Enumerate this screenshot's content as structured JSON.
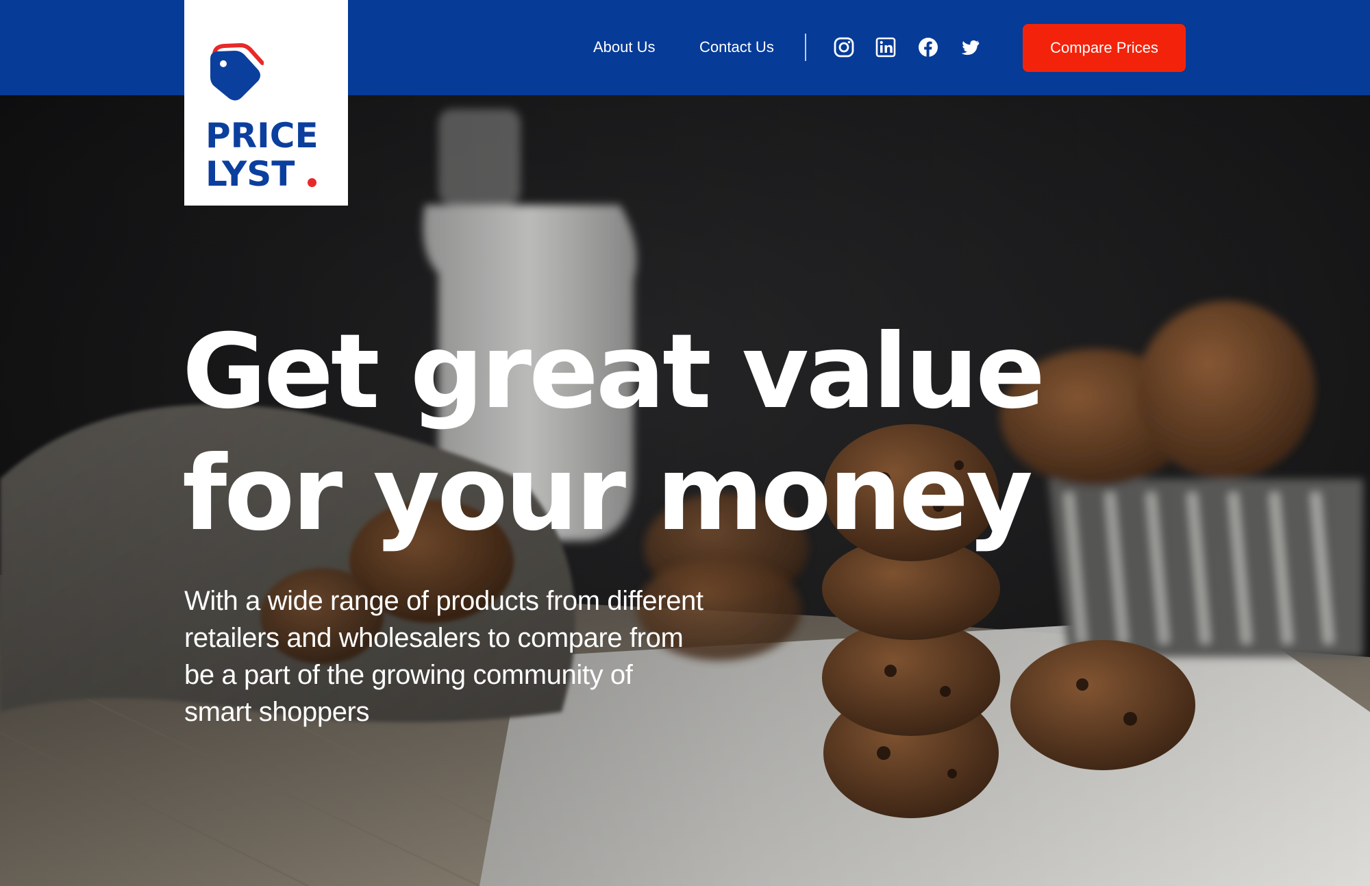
{
  "brand": {
    "line1": "PRICE",
    "line2": "LYST",
    "primary_color": "#063b98",
    "accent_color": "#f3230b",
    "logo_icon": "price-tag-icon"
  },
  "nav": {
    "links": [
      {
        "label": "About Us"
      },
      {
        "label": "Contact Us"
      }
    ],
    "social": [
      {
        "icon": "instagram-icon"
      },
      {
        "icon": "linkedin-icon"
      },
      {
        "icon": "facebook-icon"
      },
      {
        "icon": "twitter-icon"
      }
    ],
    "cta_label": "Compare Prices"
  },
  "hero": {
    "headline_line1": "Get great value",
    "headline_line2": "for your money",
    "subcopy": "With a wide range of products from different retailers and wholesalers to compare from be a part of the growing community of smart shoppers",
    "photo": "cookies-and-milk-photo"
  }
}
